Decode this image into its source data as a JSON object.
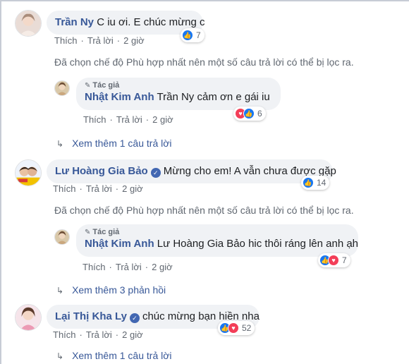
{
  "comments": [
    {
      "name": "Trần Ny",
      "text": "C iu ơi. E chúc mừng c",
      "actions": {
        "like": "Thích",
        "reply": "Trả lời",
        "time": "2 giờ"
      },
      "reactions": {
        "count": "7",
        "icons": [
          "like"
        ]
      }
    },
    {
      "author_tag": "Tác giả",
      "name": "Nhật Kim Anh",
      "mention": "Trần Ny",
      "text": "cảm ơn e gái iu",
      "actions": {
        "like": "Thích",
        "reply": "Trả lời",
        "time": "2 giờ"
      },
      "reactions": {
        "count": "6",
        "icons": [
          "love",
          "like"
        ]
      }
    },
    {
      "name": "Lư Hoàng Gia Bảo",
      "text": "Mừng cho em! A vẫn chưa được gặp",
      "actions": {
        "like": "Thích",
        "reply": "Trả lời",
        "time": "2 giờ"
      },
      "reactions": {
        "count": "14",
        "icons": [
          "like"
        ]
      }
    },
    {
      "author_tag": "Tác giả",
      "name": "Nhật Kim Anh",
      "mention": "Lư Hoàng Gia Bảo",
      "text": "hic thôi ráng lên anh ạh",
      "actions": {
        "like": "Thích",
        "reply": "Trả lời",
        "time": "2 giờ"
      },
      "reactions": {
        "count": "7",
        "icons": [
          "like",
          "love"
        ]
      }
    },
    {
      "name": "Lại Thị Kha Ly",
      "text": "chúc mừng bạn hiền nha",
      "actions": {
        "like": "Thích",
        "reply": "Trả lời",
        "time": "2 giờ"
      },
      "reactions": {
        "count": "52",
        "icons": [
          "like",
          "love"
        ]
      }
    }
  ],
  "filter_note": "Đã chọn chế độ Phù hợp nhất nên một số câu trả lời có thể bị lọc ra.",
  "more_links": {
    "first": "Xem thêm 1 câu trả lời",
    "second": "Xem thêm 3 phản hồi",
    "third": "Xem thêm 1 câu trả lời"
  },
  "colors": {
    "link": "#385898",
    "bubble": "#f0f2f5",
    "meta": "#606770",
    "like": "#1877f2",
    "love": "#f33e58"
  }
}
